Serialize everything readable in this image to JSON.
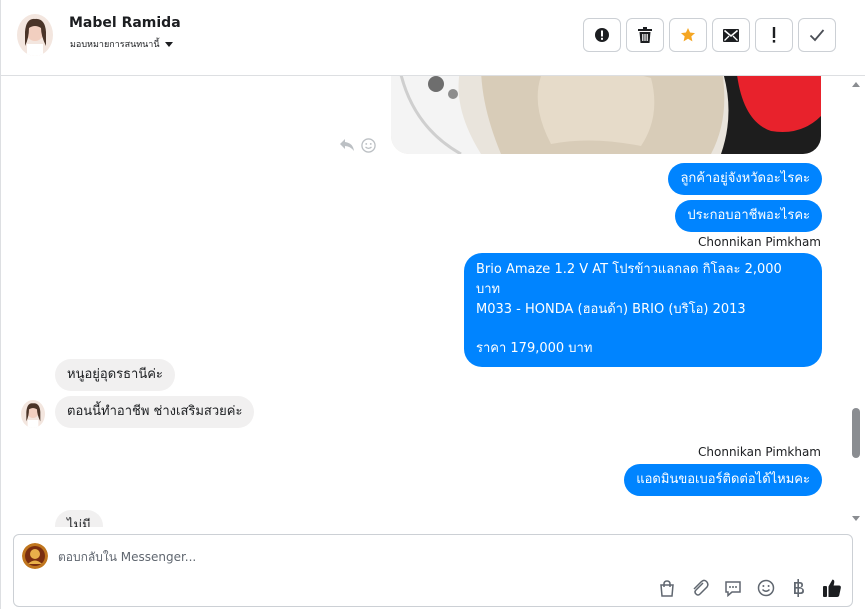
{
  "header": {
    "contact_name": "Mabel Ramida",
    "assign_label": "มอบหมายการสนทนานี้",
    "actions": [
      {
        "name": "alert-circle-button",
        "icon": "exclamation-circle-icon"
      },
      {
        "name": "delete-button",
        "icon": "trash-icon"
      },
      {
        "name": "star-button",
        "icon": "star-icon"
      },
      {
        "name": "mark-unread-button",
        "icon": "envelope-icon"
      },
      {
        "name": "follow-up-button",
        "icon": "exclamation-icon"
      },
      {
        "name": "done-button",
        "icon": "check-icon"
      }
    ]
  },
  "colors": {
    "accent_blue": "#0084ff",
    "star_orange": "#f5a623",
    "incoming_bubble": "#f1f0f0"
  },
  "messages": {
    "out_1": "ลูกค้าอยู่จังหวัดอะไรคะ",
    "out_2": "ประกอบอาชีพอะไรคะ",
    "sender_1": "Chonnikan Pimkham",
    "long_line_1": "Brio Amaze 1.2 V AT โปรข้าวแลกลด กิโลละ 2,000 บาท",
    "long_line_2": "M033 - HONDA (ฮอนด้า) BRIO (บริโอ) 2013",
    "long_line_3": "",
    "long_line_4": "ราคา 179,000 บาท",
    "in_1": "หนูอยู่อุดรธานีค่ะ",
    "in_2": "ตอนนี้ทำอาชีพ ช่างเสริมสวยค่ะ",
    "sender_2": "Chonnikan Pimkham",
    "out_3": "แอดมินขอเบอร์ติดต่อได้ไหมคะ",
    "in_partial": "ไม่มี"
  },
  "composer": {
    "placeholder": "ตอบกลับใน Messenger...",
    "value": "",
    "tools": [
      "bag-icon",
      "paperclip-icon",
      "speech-bubble-icon",
      "emoji-icon",
      "baht-icon",
      "thumbs-up-icon"
    ]
  }
}
